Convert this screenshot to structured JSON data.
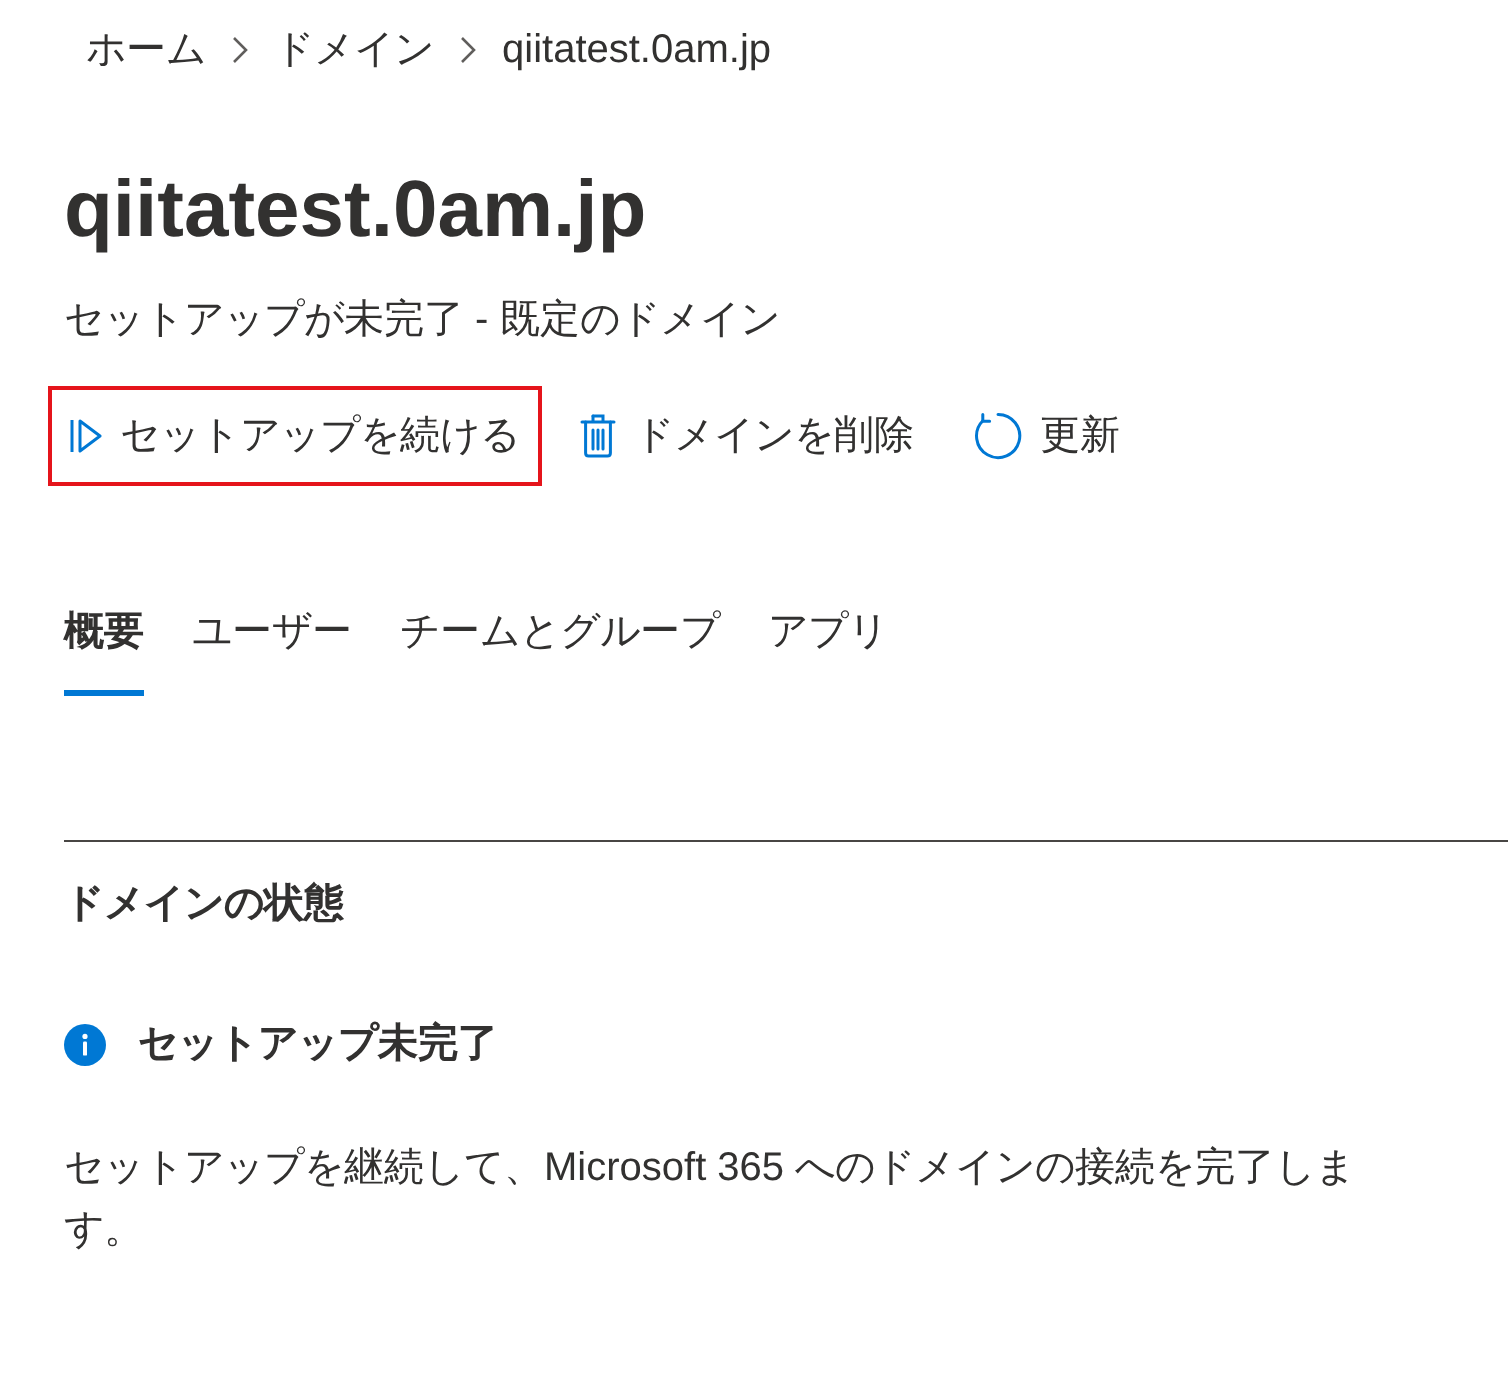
{
  "breadcrumb": [
    {
      "label": "ホーム"
    },
    {
      "label": "ドメイン"
    },
    {
      "label": "qiitatest.0am.jp"
    }
  ],
  "title": "qiitatest.0am.jp",
  "subtitle": "セットアップが未完了 - 既定のドメイン",
  "actions": [
    {
      "kind": "play",
      "label": "セットアップを続ける",
      "highlighted": true
    },
    {
      "kind": "delete",
      "label": "ドメインを削除",
      "highlighted": false
    },
    {
      "kind": "refresh",
      "label": "更新",
      "highlighted": false
    }
  ],
  "tabs": [
    {
      "label": "概要",
      "selected": true
    },
    {
      "label": "ユーザー",
      "selected": false
    },
    {
      "label": "チームとグループ",
      "selected": false
    },
    {
      "label": "アプリ",
      "selected": false
    }
  ],
  "section": {
    "heading": "ドメインの状態",
    "status": {
      "kind": "info",
      "title": "セットアップ未完了"
    },
    "description": "セットアップを継続して、Microsoft 365 へのドメインの接続を完了します。"
  }
}
